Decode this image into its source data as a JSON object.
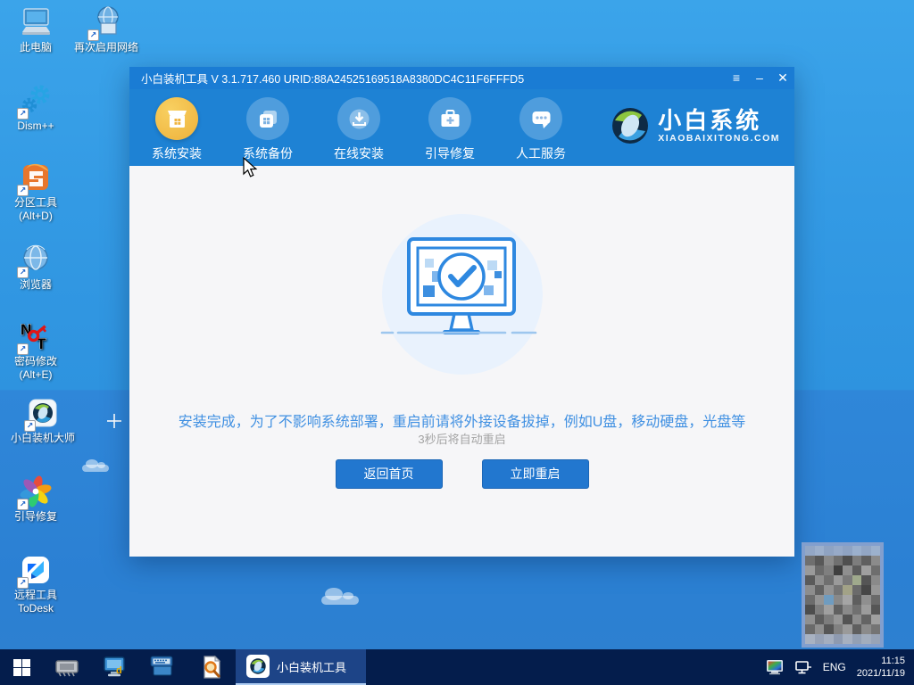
{
  "desktop": {
    "icons": [
      {
        "label": "此电脑"
      },
      {
        "label": "再次启用网络"
      },
      {
        "label": "Dism++"
      },
      {
        "label": "分区工具",
        "label2": "(Alt+D)"
      },
      {
        "label": "浏览器"
      },
      {
        "label": "密码修改",
        "label2": "(Alt+E)"
      },
      {
        "label": "小白装机大师"
      },
      {
        "label": "引导修复"
      },
      {
        "label": "远程工具",
        "label2": "ToDesk"
      }
    ]
  },
  "window": {
    "title": "小白装机工具 V 3.1.717.460 URID:88A24525169518A8380DC4C11F6FFFD5",
    "controls": {
      "menu": "≡",
      "minimize": "–",
      "close": "✕"
    },
    "tabs": [
      {
        "label": "系统安装",
        "active": true
      },
      {
        "label": "系统备份",
        "active": false
      },
      {
        "label": "在线安装",
        "active": false
      },
      {
        "label": "引导修复",
        "active": false
      },
      {
        "label": "人工服务",
        "active": false
      }
    ],
    "logo": {
      "name": "小白系统",
      "domain": "XIAOBAIXITONG.COM"
    },
    "content": {
      "message": "安装完成，为了不影响系统部署，重启前请将外接设备拔掉，例如U盘，移动硬盘，光盘等",
      "countdown": "3秒后将自动重启",
      "buttons": [
        {
          "label": "返回首页"
        },
        {
          "label": "立即重启"
        }
      ]
    }
  },
  "taskbar": {
    "app_label": "小白装机工具",
    "tray": {
      "lang": "ENG",
      "time": "11:15",
      "date": "2021/11/19"
    }
  },
  "colors": {
    "titlebar_blue": "#1a7cd4",
    "tabbar_blue": "#1e82d4",
    "active_tab_gold": "#efb33d",
    "button_blue": "#2277cf",
    "message_blue": "#4090e2",
    "taskbar_navy": "#041d4c",
    "desktop_sky": "#339ae4"
  },
  "qr": {
    "pixels": [
      [
        "#93a7c6",
        "#9db0cc",
        "#8fa3c2",
        "#97aac8",
        "#8fa3c2",
        "#9bb0cd",
        "#92a6c4",
        "#9cb1cd"
      ],
      [
        "#6f6f6f",
        "#585858",
        "#8a8a8a",
        "#707070",
        "#4f4f4f",
        "#7d7d7d",
        "#5f5f5f",
        "#8b8b8b"
      ],
      [
        "#9a9a9a",
        "#6a6a6a",
        "#7f7f7f",
        "#3f3f3f",
        "#8f8f8f",
        "#5c5c5c",
        "#9f9f9f",
        "#6e6e6e"
      ],
      [
        "#5a5a5a",
        "#8e8e8e",
        "#6f6f6f",
        "#9a9a9a",
        "#7a7a7a",
        "#9fa98c",
        "#555555",
        "#8a8a8a"
      ],
      [
        "#8d8d8d",
        "#626262",
        "#939393",
        "#757575",
        "#a2a287",
        "#6b6b6b",
        "#474747",
        "#979797"
      ],
      [
        "#6c6c6c",
        "#949494",
        "#6f9cc0",
        "#898989",
        "#a5a5a5",
        "#5e5e5e",
        "#8f8f8f",
        "#6a6a6a"
      ],
      [
        "#4d4d4d",
        "#7e7e7e",
        "#a0a0a0",
        "#606060",
        "#8a8a8a",
        "#707070",
        "#9c9c9c",
        "#565656"
      ],
      [
        "#909090",
        "#5d5d5d",
        "#7d7d7d",
        "#969696",
        "#545454",
        "#8d8d8d",
        "#646464",
        "#a0a0a0"
      ],
      [
        "#6a6a6a",
        "#8f8f8f",
        "#565656",
        "#818181",
        "#9a9a9a",
        "#5f5f5f",
        "#8b8b8b",
        "#747474"
      ],
      [
        "#a8b2c2",
        "#97a2b6",
        "#a4aebf",
        "#8e9ab0",
        "#a6b0c0",
        "#93a0b4",
        "#a2adbd",
        "#98a4b7"
      ]
    ]
  }
}
